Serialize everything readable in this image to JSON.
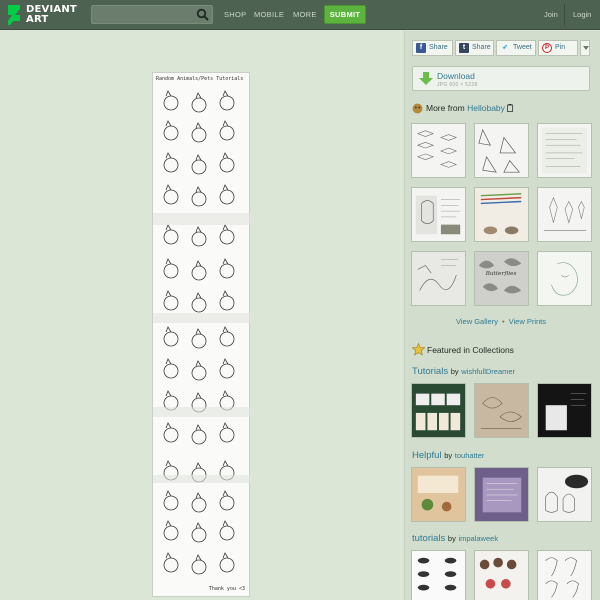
{
  "header": {
    "logo_line1": "DEVIANT",
    "logo_line2": "ART",
    "nav": [
      "SHOP",
      "MOBILE",
      "MORE"
    ],
    "submit_label": "SUBMIT",
    "join_label": "Join",
    "login_label": "Login"
  },
  "artwork": {
    "title": "Random Animals/Pets Tutorials",
    "signoff": "Thank you <3"
  },
  "share": {
    "facebook": "Share",
    "tumblr": "Share",
    "twitter": "Tweet",
    "pinterest": "Pin"
  },
  "download": {
    "label": "Download",
    "meta": "JPG 600 × 5228"
  },
  "more_from": {
    "prefix": "More from",
    "user": "Hellobaby",
    "view_gallery": "View Gallery",
    "separator": "•",
    "view_prints": "View Prints"
  },
  "featured": {
    "title": "Featured in Collections",
    "collections": [
      {
        "name": "Tutorials",
        "by": "by",
        "owner": "wishfullDreamer"
      },
      {
        "name": "Helpful",
        "by": "by",
        "owner": "touhatter"
      },
      {
        "name": "tutorials",
        "by": "by",
        "owner": "impalaweek"
      }
    ]
  },
  "colors": {
    "header_bg": "#4e6252",
    "page_bg": "#dce6d6",
    "sidebar_bg": "#d2ddcd",
    "submit_green": "#5cb33d",
    "link_blue": "#2f7a93"
  }
}
